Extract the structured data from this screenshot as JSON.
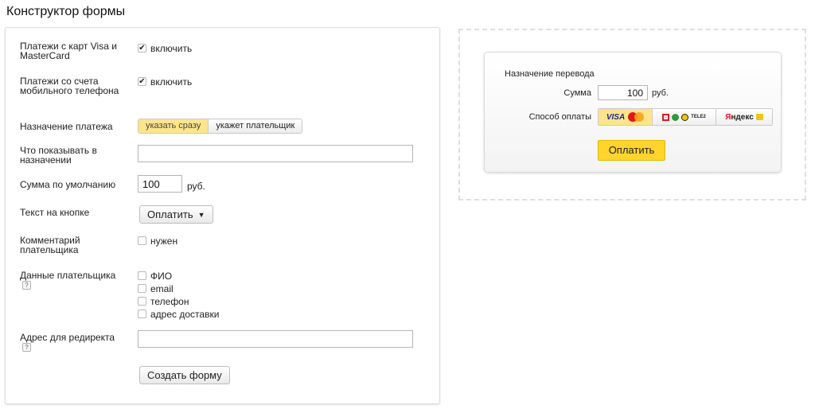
{
  "page": {
    "title": "Конструктор формы"
  },
  "form": {
    "card_payments": {
      "label": "Платежи с карт Visa и MasterCard",
      "checkbox_label": "включить",
      "checked": true
    },
    "mobile_payments": {
      "label": "Платежи со счета мобильного телефона",
      "checkbox_label": "включить",
      "checked": true
    },
    "purpose": {
      "label": "Назначение платежа",
      "options": [
        "указать сразу",
        "укажет плательщик"
      ],
      "selected": "указать сразу"
    },
    "shown_in_purpose": {
      "label": "Что показывать в назначении",
      "value": ""
    },
    "default_sum": {
      "label": "Сумма по умолчанию",
      "value": "100",
      "unit": "руб."
    },
    "button_text": {
      "label": "Текст на кнопке",
      "value": "Оплатить",
      "caret": "▼"
    },
    "payer_comment": {
      "label": "Комментарий плательщика",
      "checkbox_label": "нужен",
      "checked": false
    },
    "payer_data": {
      "label": "Данные плательщика",
      "help": "?",
      "options": [
        {
          "label": "ФИО",
          "checked": false
        },
        {
          "label": "email",
          "checked": false
        },
        {
          "label": "телефон",
          "checked": false
        },
        {
          "label": "адрес доставки",
          "checked": false
        }
      ]
    },
    "redirect": {
      "label": "Адрес для редиректа",
      "help": "?",
      "value": ""
    },
    "create_button": "Создать форму",
    "check_mark": "✔"
  },
  "preview": {
    "purpose_label": "Назначение перевода",
    "sum_label": "Сумма",
    "sum_value": "100",
    "sum_unit": "руб.",
    "method_label": "Способ оплаты",
    "methods": {
      "card": {
        "visa": "VISA",
        "selected": true
      },
      "mobile": {
        "tele2": "TELE2"
      },
      "yandex": {
        "text_ya": "Я",
        "text_rest": "ндекс"
      }
    },
    "pay_button": "Оплатить"
  },
  "colors": {
    "accent_yellow": "#ffd42d",
    "selected_segment": "#ffe58a",
    "panel_border": "#dcdcdc",
    "dashed_border": "#dedede"
  }
}
